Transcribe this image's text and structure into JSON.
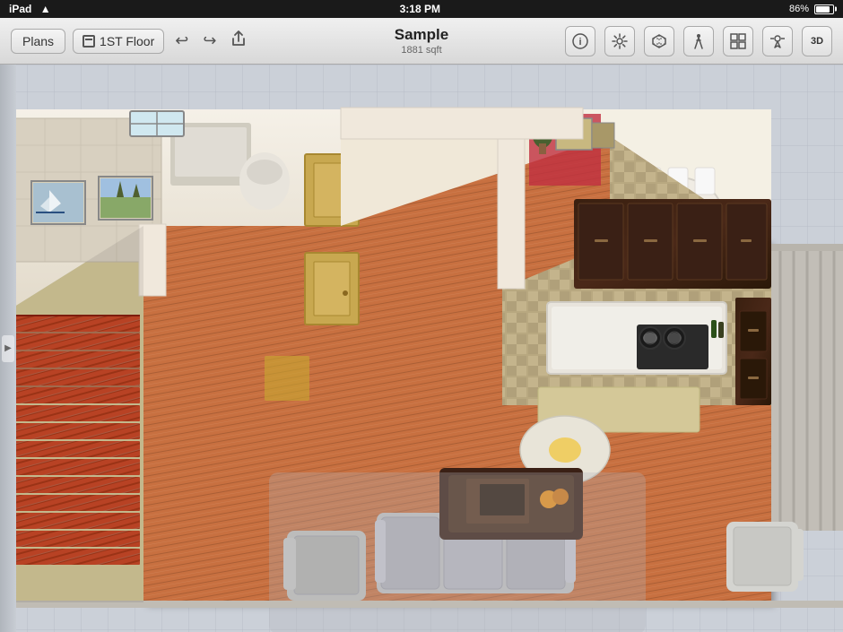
{
  "statusBar": {
    "carrier": "iPad",
    "time": "3:18 PM",
    "wifi": "WiFi",
    "battery": "86%"
  },
  "toolbar": {
    "plansLabel": "Plans",
    "floorLabel": "1ST Floor",
    "appTitle": "Sample",
    "appSubtitle": "1881 sqft",
    "undoLabel": "↩",
    "redoLabel": "↪",
    "shareLabel": "⬆",
    "infoLabel": "ⓘ",
    "settingsLabel": "⚙",
    "3dBoxLabel": "⬛",
    "walkLabel": "🚶",
    "layoutLabel": "⊞",
    "umbrellaLabel": "☂",
    "3dViewLabel": "3D"
  },
  "floorPlan": {
    "name": "Sample",
    "sqft": "1881 sqft",
    "floor": "1ST Floor"
  }
}
